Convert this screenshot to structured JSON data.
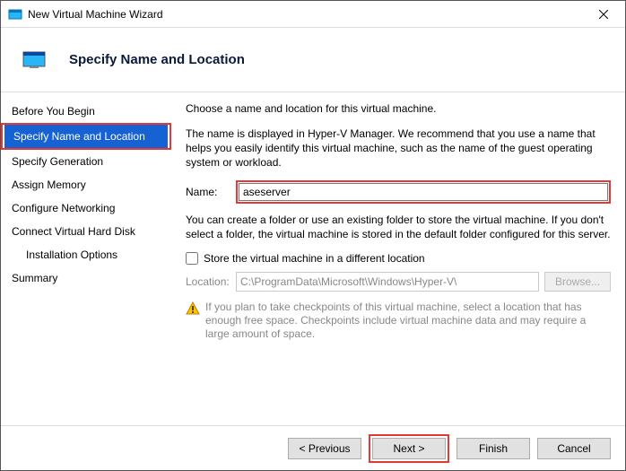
{
  "window": {
    "title": "New Virtual Machine Wizard"
  },
  "header": {
    "title": "Specify Name and Location"
  },
  "sidebar": {
    "items": [
      {
        "label": "Before You Begin",
        "indent": false,
        "selected": false
      },
      {
        "label": "Specify Name and Location",
        "indent": false,
        "selected": true
      },
      {
        "label": "Specify Generation",
        "indent": false,
        "selected": false
      },
      {
        "label": "Assign Memory",
        "indent": false,
        "selected": false
      },
      {
        "label": "Configure Networking",
        "indent": false,
        "selected": false
      },
      {
        "label": "Connect Virtual Hard Disk",
        "indent": false,
        "selected": false
      },
      {
        "label": "Installation Options",
        "indent": true,
        "selected": false
      },
      {
        "label": "Summary",
        "indent": false,
        "selected": false
      }
    ]
  },
  "main": {
    "intro": "Choose a name and location for this virtual machine.",
    "desc": "The name is displayed in Hyper-V Manager. We recommend that you use a name that helps you easily identify this virtual machine, such as the name of the guest operating system or workload.",
    "name_label": "Name:",
    "name_value": "aseserver",
    "folder_desc": "You can create a folder or use an existing folder to store the virtual machine. If you don't select a folder, the virtual machine is stored in the default folder configured for this server.",
    "checkbox_label": "Store the virtual machine in a different location",
    "location_label": "Location:",
    "location_value": "C:\\ProgramData\\Microsoft\\Windows\\Hyper-V\\",
    "browse_label": "Browse...",
    "info": "If you plan to take checkpoints of this virtual machine, select a location that has enough free space. Checkpoints include virtual machine data and may require a large amount of space."
  },
  "footer": {
    "previous": "< Previous",
    "next": "Next >",
    "finish": "Finish",
    "cancel": "Cancel"
  }
}
